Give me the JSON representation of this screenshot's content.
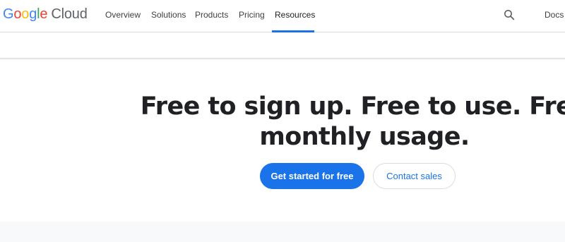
{
  "brand": {
    "logo_letters": [
      "G",
      "o",
      "o",
      "g",
      "l",
      "e"
    ],
    "logo_product": "Cloud"
  },
  "nav": {
    "items": [
      {
        "label": "Overview"
      },
      {
        "label": "Solutions"
      },
      {
        "label": "Products"
      },
      {
        "label": "Pricing"
      },
      {
        "label": "Resources",
        "active": true
      }
    ],
    "search_icon": "search-icon",
    "docs_label": "Docs"
  },
  "hero": {
    "title": "Free to sign up. Free to use. Free monthly usage.",
    "primary_cta": "Get started for free",
    "secondary_cta": "Contact sales"
  },
  "colors": {
    "accent": "#1a73e8",
    "text": "#202124",
    "muted": "#5f6368",
    "border": "#dadce0",
    "band": "#f8f9fa"
  }
}
